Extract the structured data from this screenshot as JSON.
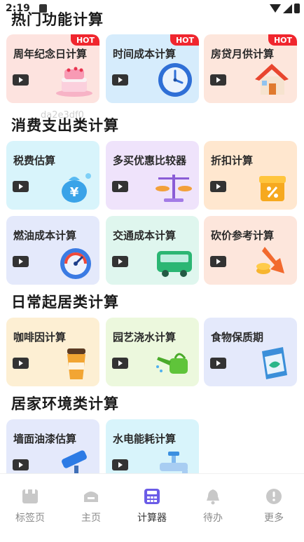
{
  "status_bar": {
    "time": "2:19"
  },
  "watermark": "da2e3df0",
  "sections": [
    {
      "title": "热门功能计算"
    },
    {
      "title": "消费支出类计算"
    },
    {
      "title": "日常起居类计算"
    },
    {
      "title": "居家环境类计算"
    }
  ],
  "hot_badge": "HOT",
  "cards": [
    {
      "title": "周年纪念日计算",
      "icon": "cake-icon"
    },
    {
      "title": "时间成本计算",
      "icon": "clock-icon"
    },
    {
      "title": "房贷月供计算",
      "icon": "house-icon"
    },
    {
      "title": "税费估算",
      "icon": "money-bag-icon"
    },
    {
      "title": "多买优惠比较器",
      "icon": "scale-icon"
    },
    {
      "title": "折扣计算",
      "icon": "discount-box-icon"
    },
    {
      "title": "燃油成本计算",
      "icon": "fuel-gauge-icon"
    },
    {
      "title": "交通成本计算",
      "icon": "bus-icon"
    },
    {
      "title": "砍价参考计算",
      "icon": "coins-down-arrow-icon"
    },
    {
      "title": "咖啡因计算",
      "icon": "coffee-cup-icon"
    },
    {
      "title": "园艺浇水计算",
      "icon": "watering-can-icon"
    },
    {
      "title": "食物保质期",
      "icon": "food-bag-icon"
    },
    {
      "title": "墙面油漆估算",
      "icon": "paint-roller-icon"
    },
    {
      "title": "水电能耗计算",
      "icon": "water-tap-icon"
    }
  ],
  "bottom_nav": [
    {
      "label": "标签页",
      "icon": "tabs-icon",
      "active": false
    },
    {
      "label": "主页",
      "icon": "home-icon",
      "active": false
    },
    {
      "label": "计算器",
      "icon": "calculator-icon",
      "active": true
    },
    {
      "label": "待办",
      "icon": "bell-icon",
      "active": false
    },
    {
      "label": "更多",
      "icon": "more-icon",
      "active": false
    }
  ],
  "colors": {
    "accent": "#6b5ce7",
    "hot_badge": "#f0262e",
    "nav_inactive": "#c8c8c8"
  }
}
